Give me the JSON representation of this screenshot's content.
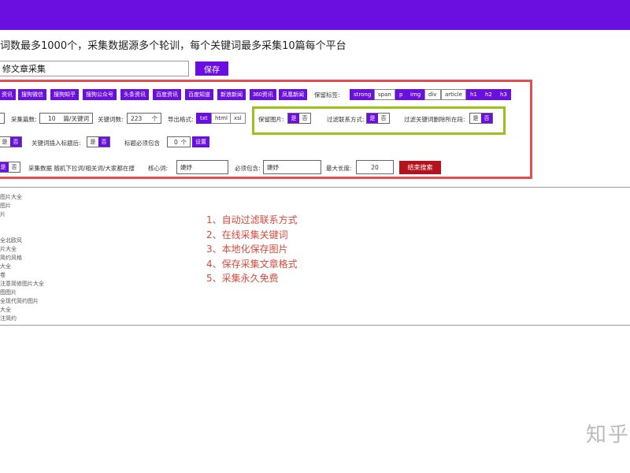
{
  "intro_text": "词数最多1000个，采集数据源多个轮训，每个关键词最多采集10篇每个平台",
  "title_input": {
    "value": "修文章采集"
  },
  "save_label": "保存",
  "sources": [
    "资讯",
    "搜狗微信",
    "搜狗知乎",
    "搜狗公众号",
    "头条资讯",
    "百度资讯",
    "百度知道",
    "新浪新闻",
    "360资讯",
    "凤凰新闻"
  ],
  "keep_tags_label": "保留标签:",
  "tags": [
    {
      "label": "strong",
      "on": true
    },
    {
      "label": "span",
      "on": false
    },
    {
      "label": "p",
      "on": true
    },
    {
      "label": "img",
      "on": true
    },
    {
      "label": "div",
      "on": false
    },
    {
      "label": "article",
      "on": false
    },
    {
      "label": "h1",
      "on": true
    },
    {
      "label": "h2",
      "on": true
    },
    {
      "label": "h3",
      "on": true
    }
  ],
  "row2": {
    "collect_count_label": "采集篇数:",
    "collect_count_value": "10",
    "collect_count_unit": "篇/关键词",
    "keyword_count_label": "关键词数:",
    "keyword_count_value": "223",
    "keyword_count_unit": "个",
    "export_label": "导出格式:",
    "export_options": [
      {
        "label": "txt",
        "on": true
      },
      {
        "label": "html",
        "on": false
      },
      {
        "label": "xsl",
        "on": false
      }
    ],
    "keep_images_label": "保留图片:",
    "filter_contact_label": "过滤联系方式:",
    "filter_keyword_para_label": "过滤关键词删除所在段:",
    "yes": "是",
    "no": "否"
  },
  "row3": {
    "keyword_insert_title_label": "关键词插入标题后:",
    "title_must_contain_label": "标题必须包含",
    "title_must_contain_value": "0",
    "title_must_contain_unit": "个",
    "set_label": "设置"
  },
  "row4": {
    "random_label": "采集数据 随机下拉词/相关词/大家都在搜",
    "core_word_label": "核心词:",
    "core_word_value": "婕妤",
    "must_contain_label": "必须包含:",
    "must_contain_value": "婕妤",
    "max_length_label": "最大长度:",
    "max_length_value": "20",
    "end_search_label": "结束搜索"
  },
  "results": [
    "图片大全",
    "图片",
    "片",
    "",
    "",
    "全北欧风",
    "片大全",
    "简约风格",
    "大全",
    "卷",
    "注意简修图片大全",
    "图图片",
    "全现代简约图片",
    "大全",
    "注简约"
  ],
  "features": [
    "1、自动过滤联系方式",
    "2、在线采集关键词",
    "3、本地化保存图片",
    "4、保存采集文章格式",
    "5、采集永久免费"
  ],
  "watermark": "知乎",
  "colors": {
    "accent": "#6a0fe0",
    "panel_border": "#e05050",
    "highlight_border": "#9ac21a",
    "danger": "#b5121b",
    "feature_text": "#d44b3d"
  }
}
